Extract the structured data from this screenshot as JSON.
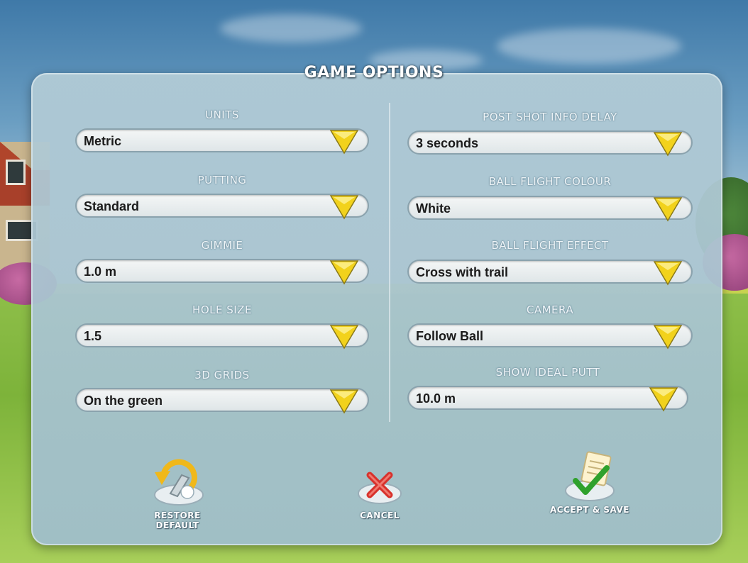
{
  "title": "GAME OPTIONS",
  "left_options": [
    {
      "label": "UNITS",
      "value": "Metric"
    },
    {
      "label": "PUTTING",
      "value": "Standard"
    },
    {
      "label": "GIMMIE",
      "value": "1.0 m"
    },
    {
      "label": "HOLE SIZE",
      "value": "1.5"
    },
    {
      "label": "3D GRIDS",
      "value": "On the green"
    }
  ],
  "right_options": [
    {
      "label": "POST SHOT INFO DELAY",
      "value": "3 seconds"
    },
    {
      "label": "BALL FLIGHT COLOUR",
      "value": "White"
    },
    {
      "label": "BALL FLIGHT EFFECT",
      "value": "Cross with trail"
    },
    {
      "label": "CAMERA",
      "value": "Follow Ball"
    },
    {
      "label": "SHOW IDEAL PUTT",
      "value": "10.0 m"
    }
  ],
  "actions": {
    "restore_line1": "RESTORE",
    "restore_line2": "DEFAULT",
    "cancel": "CANCEL",
    "accept": "ACCEPT & SAVE"
  },
  "colors": {
    "chevron": "#f2d21c",
    "panel": "#a9c4d0",
    "cancel": "#d8322c",
    "accept": "#2fa12c"
  }
}
